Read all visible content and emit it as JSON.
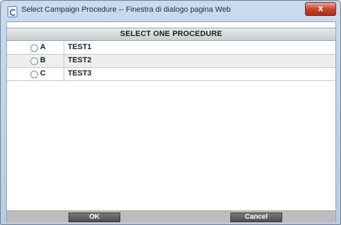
{
  "window": {
    "title": "Select Campaign Procedure -- Finestra di dialogo pagina Web",
    "icon": "ie-page-icon",
    "close_label": "x"
  },
  "header": {
    "title": "SELECT ONE PROCEDURE"
  },
  "procedures": [
    {
      "letter": "A",
      "name": "TEST1",
      "selected": false
    },
    {
      "letter": "B",
      "name": "TEST2",
      "selected": false
    },
    {
      "letter": "C",
      "name": "TEST3",
      "selected": false
    }
  ],
  "buttons": {
    "ok_label": "OK",
    "cancel_label": "Cancel"
  },
  "colors": {
    "titlebar": "#b6cce4",
    "close_button": "#c8442c",
    "header_bg": "#c9cdd1",
    "button_bg": "#4e4e4e",
    "footer_bg": "#bdbdbd"
  }
}
